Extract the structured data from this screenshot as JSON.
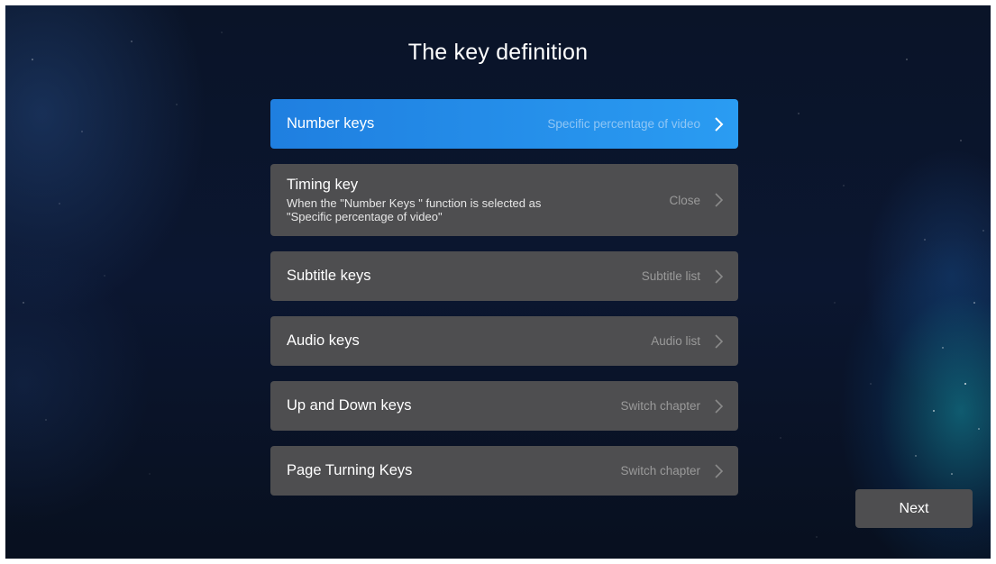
{
  "page": {
    "title": "The key definition"
  },
  "menu": {
    "items": [
      {
        "label": "Number keys",
        "value": "Specific percentage of video",
        "selected": true
      },
      {
        "label": "Timing key",
        "description": "When the \"Number Keys \" function is selected as\n\"Specific percentage of video\"",
        "value": "Close",
        "selected": false
      },
      {
        "label": "Subtitle keys",
        "value": "Subtitle list",
        "selected": false
      },
      {
        "label": "Audio keys",
        "value": "Audio list",
        "selected": false
      },
      {
        "label": "Up and Down keys",
        "value": "Switch chapter",
        "selected": false
      },
      {
        "label": "Page Turning Keys",
        "value": "Switch chapter",
        "selected": false
      }
    ]
  },
  "footer": {
    "next_label": "Next"
  },
  "colors": {
    "selected_row": "#2a8ee8",
    "row": "#4e4e50",
    "background": "#0b1630"
  }
}
